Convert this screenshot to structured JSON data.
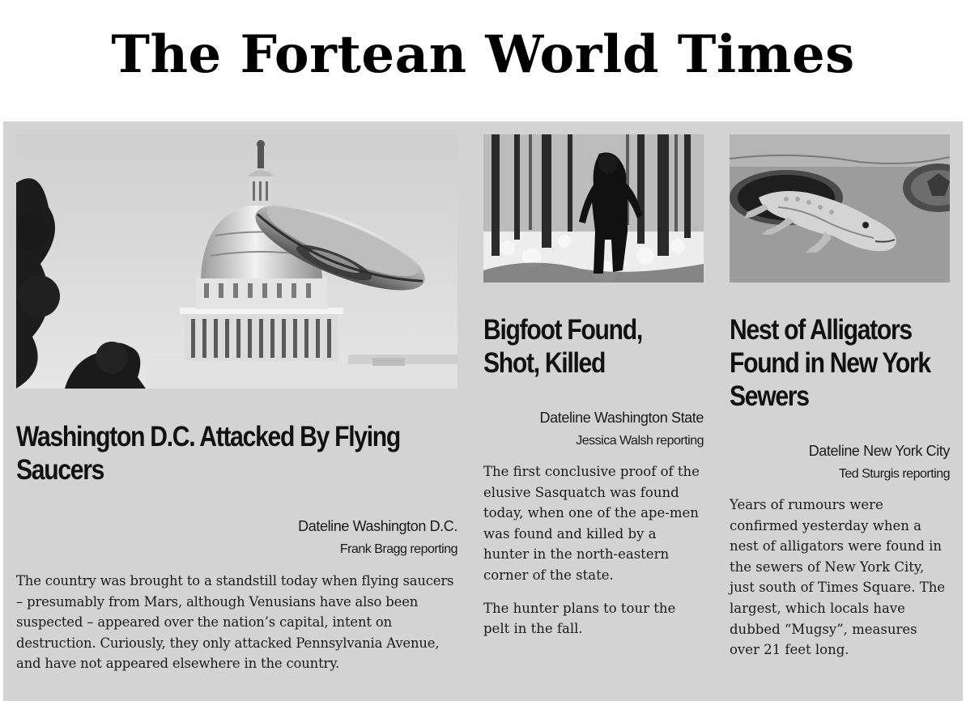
{
  "masthead": {
    "title": "The Fortean World Times"
  },
  "articles": [
    {
      "image_subject": "flying saucer over the Capitol dome",
      "headline": "Washington D.C. Attacked By Flying Saucers",
      "dateline": "Dateline Washington D.C.",
      "reporter": "Frank Bragg reporting",
      "paragraphs": [
        "The country was brought to a standstill today when flying saucers – presumably from Mars, although Venusians have also been suspected – appeared over the nation’s capital, intent on destruction. Curiously, they only attacked Pennsylvania Avenue, and have not appeared elsewhere in the country."
      ]
    },
    {
      "image_subject": "bigfoot walking in a snowy forest",
      "headline": "Bigfoot Found, Shot, Killed",
      "dateline": "Dateline Washington State",
      "reporter": "Jessica Walsh reporting",
      "paragraphs": [
        "The first conclusive proof of the elusive Sasquatch was found today, when one of the ape-men was found and killed by a hunter in the north-eastern corner of the state.",
        "The hunter plans to tour the pelt in the fall."
      ]
    },
    {
      "image_subject": "alligator emerging from a sewer manhole",
      "headline": "Nest of Alligators Found in New York Sewers",
      "dateline": "Dateline New York City",
      "reporter": "Ted Sturgis reporting",
      "paragraphs": [
        "Years of rumours were confirmed yesterday when a nest of alligators were found in the sewers of New York City, just south of Times Square. The largest, which locals have dubbed “Mugsy”, measures over 21 feet long."
      ]
    }
  ],
  "colors": {
    "paper_background": "#d3d3d3",
    "page_background": "#ffffff",
    "ink": "#111111"
  }
}
